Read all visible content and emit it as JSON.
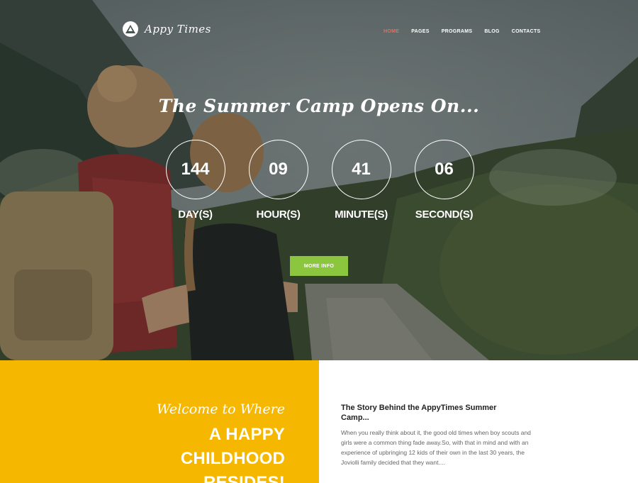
{
  "brand": {
    "name": "Appy Times"
  },
  "nav": {
    "items": [
      {
        "label": "HOME",
        "active": true
      },
      {
        "label": "PAGES",
        "active": false
      },
      {
        "label": "PROGRAMS",
        "active": false
      },
      {
        "label": "BLOG",
        "active": false
      },
      {
        "label": "CONTACTS",
        "active": false
      }
    ],
    "active_color": "#f1695a"
  },
  "hero": {
    "headline": "The Summer Camp Opens On...",
    "countdown": [
      {
        "value": "144",
        "label": "DAY(S)"
      },
      {
        "value": "09",
        "label": "HOUR(S)"
      },
      {
        "value": "41",
        "label": "MINUTE(S)"
      },
      {
        "value": "06",
        "label": "SECOND(S)"
      }
    ],
    "button_label": "MORE INFO",
    "button_color": "#8cc63f"
  },
  "welcome": {
    "script_line": "Welcome to Where",
    "heading_line1": "A HAPPY CHILDHOOD",
    "heading_line2": "RESIDES!",
    "background": "#f5b700"
  },
  "story": {
    "title": "The Story Behind the AppyTimes Summer Camp...",
    "body": "When you really think about it, the good old times when boy scouts and girls were a common thing fade away.So, with that in mind and with an experience of upbringing 12 kids of their own in the last 30 years, the Joviolli family decided that they want...."
  }
}
